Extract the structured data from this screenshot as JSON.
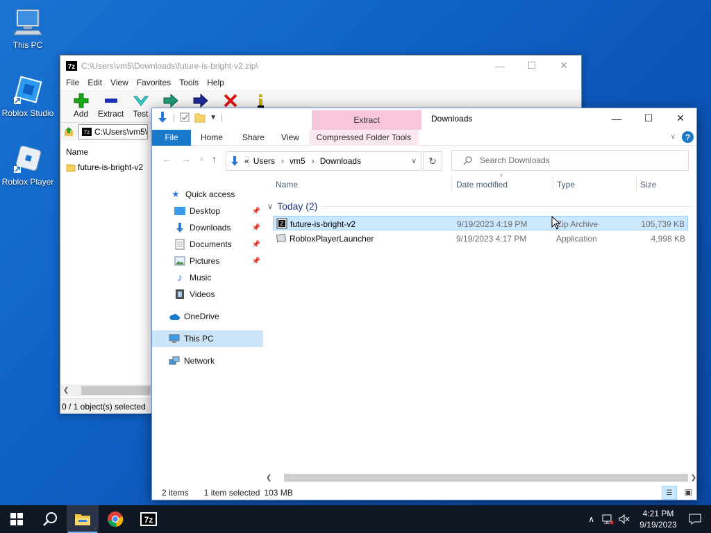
{
  "desktop": {
    "icons": [
      {
        "label": "This PC"
      },
      {
        "label": "Roblox Studio"
      },
      {
        "label": "Roblox Player"
      }
    ]
  },
  "sevenzip": {
    "title": "C:\\Users\\vm5\\Downloads\\future-is-bright-v2.zip\\",
    "menu": [
      "File",
      "Edit",
      "View",
      "Favorites",
      "Tools",
      "Help"
    ],
    "toolbar": [
      "Add",
      "Extract",
      "Test"
    ],
    "address": "C:\\Users\\vm5\\",
    "column_name": "Name",
    "file": "future-is-bright-v2",
    "status": "0 / 1 object(s) selected"
  },
  "explorer": {
    "context_tab": "Extract",
    "title": "Downloads",
    "tabs": {
      "file": "File",
      "home": "Home",
      "share": "Share",
      "view": "View",
      "compressed": "Compressed Folder Tools"
    },
    "breadcrumb": {
      "prefix": "«",
      "items": [
        "Users",
        "vm5",
        "Downloads"
      ]
    },
    "search_placeholder": "Search Downloads",
    "nav": {
      "quick_access": "Quick access",
      "desktop": "Desktop",
      "downloads": "Downloads",
      "documents": "Documents",
      "pictures": "Pictures",
      "music": "Music",
      "videos": "Videos",
      "onedrive": "OneDrive",
      "this_pc": "This PC",
      "network": "Network"
    },
    "columns": {
      "name": "Name",
      "date": "Date modified",
      "type": "Type",
      "size": "Size"
    },
    "group": "Today (2)",
    "files": [
      {
        "name": "future-is-bright-v2",
        "date": "9/19/2023 4:19 PM",
        "type": "Zip Archive",
        "size": "105,739 KB"
      },
      {
        "name": "RobloxPlayerLauncher",
        "date": "9/19/2023 4:17 PM",
        "type": "Application",
        "size": "4,998 KB"
      }
    ],
    "status": {
      "items": "2 items",
      "selected": "1 item selected",
      "size": "103 MB"
    }
  },
  "taskbar": {
    "apps": [
      "start",
      "search",
      "file-explorer",
      "chrome",
      "7zip"
    ],
    "time": "4:21 PM",
    "date": "9/19/2023",
    "colors": {
      "taskbar": "#101826",
      "accent": "#1979ca"
    }
  }
}
